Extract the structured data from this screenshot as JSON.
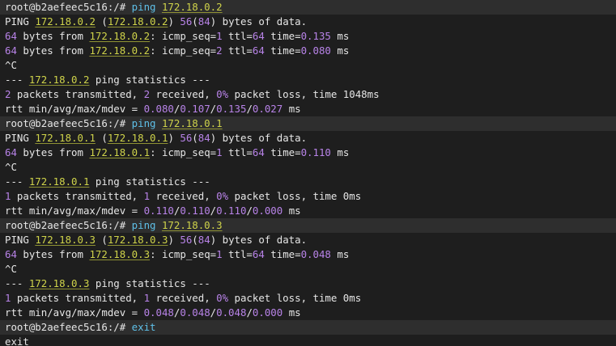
{
  "colors": {
    "background": "#1e1e1e",
    "prompt_row_background": "#2e2e2e",
    "text": "#e6e6e6",
    "ip_address": "#cfd34a",
    "number": "#b883e8",
    "command": "#5fc0e8"
  },
  "lines": [
    {
      "prompt": true,
      "segments": [
        {
          "t": "root@b2aefeec5c16:/# ",
          "s": "plain"
        },
        {
          "t": "ping ",
          "s": "cmd"
        },
        {
          "t": "172.18.0.2",
          "s": "ip"
        }
      ]
    },
    {
      "prompt": false,
      "segments": [
        {
          "t": "PING ",
          "s": "plain"
        },
        {
          "t": "172.18.0.2",
          "s": "ip"
        },
        {
          "t": " (",
          "s": "plain"
        },
        {
          "t": "172.18.0.2",
          "s": "ip"
        },
        {
          "t": ") ",
          "s": "plain"
        },
        {
          "t": "56",
          "s": "num"
        },
        {
          "t": "(",
          "s": "plain"
        },
        {
          "t": "84",
          "s": "num"
        },
        {
          "t": ") bytes of data.",
          "s": "plain"
        }
      ]
    },
    {
      "prompt": false,
      "segments": [
        {
          "t": "64",
          "s": "num"
        },
        {
          "t": " bytes from ",
          "s": "plain"
        },
        {
          "t": "172.18.0.2",
          "s": "ip"
        },
        {
          "t": ": icmp_seq=",
          "s": "plain"
        },
        {
          "t": "1",
          "s": "num"
        },
        {
          "t": " ttl=",
          "s": "plain"
        },
        {
          "t": "64",
          "s": "num"
        },
        {
          "t": " time=",
          "s": "plain"
        },
        {
          "t": "0.135",
          "s": "num"
        },
        {
          "t": " ms",
          "s": "plain"
        }
      ]
    },
    {
      "prompt": false,
      "segments": [
        {
          "t": "64",
          "s": "num"
        },
        {
          "t": " bytes from ",
          "s": "plain"
        },
        {
          "t": "172.18.0.2",
          "s": "ip"
        },
        {
          "t": ": icmp_seq=",
          "s": "plain"
        },
        {
          "t": "2",
          "s": "num"
        },
        {
          "t": " ttl=",
          "s": "plain"
        },
        {
          "t": "64",
          "s": "num"
        },
        {
          "t": " time=",
          "s": "plain"
        },
        {
          "t": "0.080",
          "s": "num"
        },
        {
          "t": " ms",
          "s": "plain"
        }
      ]
    },
    {
      "prompt": false,
      "segments": [
        {
          "t": "^C",
          "s": "plain"
        }
      ]
    },
    {
      "prompt": false,
      "segments": [
        {
          "t": "--- ",
          "s": "plain"
        },
        {
          "t": "172.18.0.2",
          "s": "ip"
        },
        {
          "t": " ping statistics ---",
          "s": "plain"
        }
      ]
    },
    {
      "prompt": false,
      "segments": [
        {
          "t": "2",
          "s": "num"
        },
        {
          "t": " packets transmitted, ",
          "s": "plain"
        },
        {
          "t": "2",
          "s": "num"
        },
        {
          "t": " received, ",
          "s": "plain"
        },
        {
          "t": "0%",
          "s": "num"
        },
        {
          "t": " packet loss, time 1048ms",
          "s": "plain"
        }
      ]
    },
    {
      "prompt": false,
      "segments": [
        {
          "t": "rtt min/avg/max/mdev = ",
          "s": "plain"
        },
        {
          "t": "0.080",
          "s": "num"
        },
        {
          "t": "/",
          "s": "plain"
        },
        {
          "t": "0.107",
          "s": "num"
        },
        {
          "t": "/",
          "s": "plain"
        },
        {
          "t": "0.135",
          "s": "num"
        },
        {
          "t": "/",
          "s": "plain"
        },
        {
          "t": "0.027",
          "s": "num"
        },
        {
          "t": " ms",
          "s": "plain"
        }
      ]
    },
    {
      "prompt": true,
      "segments": [
        {
          "t": "root@b2aefeec5c16:/# ",
          "s": "plain"
        },
        {
          "t": "ping ",
          "s": "cmd"
        },
        {
          "t": "172.18.0.1",
          "s": "ip"
        }
      ]
    },
    {
      "prompt": false,
      "segments": [
        {
          "t": "PING ",
          "s": "plain"
        },
        {
          "t": "172.18.0.1",
          "s": "ip"
        },
        {
          "t": " (",
          "s": "plain"
        },
        {
          "t": "172.18.0.1",
          "s": "ip"
        },
        {
          "t": ") ",
          "s": "plain"
        },
        {
          "t": "56",
          "s": "num"
        },
        {
          "t": "(",
          "s": "plain"
        },
        {
          "t": "84",
          "s": "num"
        },
        {
          "t": ") bytes of data.",
          "s": "plain"
        }
      ]
    },
    {
      "prompt": false,
      "segments": [
        {
          "t": "64",
          "s": "num"
        },
        {
          "t": " bytes from ",
          "s": "plain"
        },
        {
          "t": "172.18.0.1",
          "s": "ip"
        },
        {
          "t": ": icmp_seq=",
          "s": "plain"
        },
        {
          "t": "1",
          "s": "num"
        },
        {
          "t": " ttl=",
          "s": "plain"
        },
        {
          "t": "64",
          "s": "num"
        },
        {
          "t": " time=",
          "s": "plain"
        },
        {
          "t": "0.110",
          "s": "num"
        },
        {
          "t": " ms",
          "s": "plain"
        }
      ]
    },
    {
      "prompt": false,
      "segments": [
        {
          "t": "^C",
          "s": "plain"
        }
      ]
    },
    {
      "prompt": false,
      "segments": [
        {
          "t": "--- ",
          "s": "plain"
        },
        {
          "t": "172.18.0.1",
          "s": "ip"
        },
        {
          "t": " ping statistics ---",
          "s": "plain"
        }
      ]
    },
    {
      "prompt": false,
      "segments": [
        {
          "t": "1",
          "s": "num"
        },
        {
          "t": " packets transmitted, ",
          "s": "plain"
        },
        {
          "t": "1",
          "s": "num"
        },
        {
          "t": " received, ",
          "s": "plain"
        },
        {
          "t": "0%",
          "s": "num"
        },
        {
          "t": " packet loss, time 0ms",
          "s": "plain"
        }
      ]
    },
    {
      "prompt": false,
      "segments": [
        {
          "t": "rtt min/avg/max/mdev = ",
          "s": "plain"
        },
        {
          "t": "0.110",
          "s": "num"
        },
        {
          "t": "/",
          "s": "plain"
        },
        {
          "t": "0.110",
          "s": "num"
        },
        {
          "t": "/",
          "s": "plain"
        },
        {
          "t": "0.110",
          "s": "num"
        },
        {
          "t": "/",
          "s": "plain"
        },
        {
          "t": "0.000",
          "s": "num"
        },
        {
          "t": " ms",
          "s": "plain"
        }
      ]
    },
    {
      "prompt": true,
      "segments": [
        {
          "t": "root@b2aefeec5c16:/# ",
          "s": "plain"
        },
        {
          "t": "ping ",
          "s": "cmd"
        },
        {
          "t": "172.18.0.3",
          "s": "ip"
        }
      ]
    },
    {
      "prompt": false,
      "segments": [
        {
          "t": "PING ",
          "s": "plain"
        },
        {
          "t": "172.18.0.3",
          "s": "ip"
        },
        {
          "t": " (",
          "s": "plain"
        },
        {
          "t": "172.18.0.3",
          "s": "ip"
        },
        {
          "t": ") ",
          "s": "plain"
        },
        {
          "t": "56",
          "s": "num"
        },
        {
          "t": "(",
          "s": "plain"
        },
        {
          "t": "84",
          "s": "num"
        },
        {
          "t": ") bytes of data.",
          "s": "plain"
        }
      ]
    },
    {
      "prompt": false,
      "segments": [
        {
          "t": "64",
          "s": "num"
        },
        {
          "t": " bytes from ",
          "s": "plain"
        },
        {
          "t": "172.18.0.3",
          "s": "ip"
        },
        {
          "t": ": icmp_seq=",
          "s": "plain"
        },
        {
          "t": "1",
          "s": "num"
        },
        {
          "t": " ttl=",
          "s": "plain"
        },
        {
          "t": "64",
          "s": "num"
        },
        {
          "t": " time=",
          "s": "plain"
        },
        {
          "t": "0.048",
          "s": "num"
        },
        {
          "t": " ms",
          "s": "plain"
        }
      ]
    },
    {
      "prompt": false,
      "segments": [
        {
          "t": "^C",
          "s": "plain"
        }
      ]
    },
    {
      "prompt": false,
      "segments": [
        {
          "t": "--- ",
          "s": "plain"
        },
        {
          "t": "172.18.0.3",
          "s": "ip"
        },
        {
          "t": " ping statistics ---",
          "s": "plain"
        }
      ]
    },
    {
      "prompt": false,
      "segments": [
        {
          "t": "1",
          "s": "num"
        },
        {
          "t": " packets transmitted, ",
          "s": "plain"
        },
        {
          "t": "1",
          "s": "num"
        },
        {
          "t": " received, ",
          "s": "plain"
        },
        {
          "t": "0%",
          "s": "num"
        },
        {
          "t": " packet loss, time 0ms",
          "s": "plain"
        }
      ]
    },
    {
      "prompt": false,
      "segments": [
        {
          "t": "rtt min/avg/max/mdev = ",
          "s": "plain"
        },
        {
          "t": "0.048",
          "s": "num"
        },
        {
          "t": "/",
          "s": "plain"
        },
        {
          "t": "0.048",
          "s": "num"
        },
        {
          "t": "/",
          "s": "plain"
        },
        {
          "t": "0.048",
          "s": "num"
        },
        {
          "t": "/",
          "s": "plain"
        },
        {
          "t": "0.000",
          "s": "num"
        },
        {
          "t": " ms",
          "s": "plain"
        }
      ]
    },
    {
      "prompt": true,
      "segments": [
        {
          "t": "root@b2aefeec5c16:/# ",
          "s": "plain"
        },
        {
          "t": "exit",
          "s": "cmd"
        }
      ]
    },
    {
      "prompt": false,
      "segments": [
        {
          "t": "exit",
          "s": "plain"
        }
      ]
    }
  ]
}
